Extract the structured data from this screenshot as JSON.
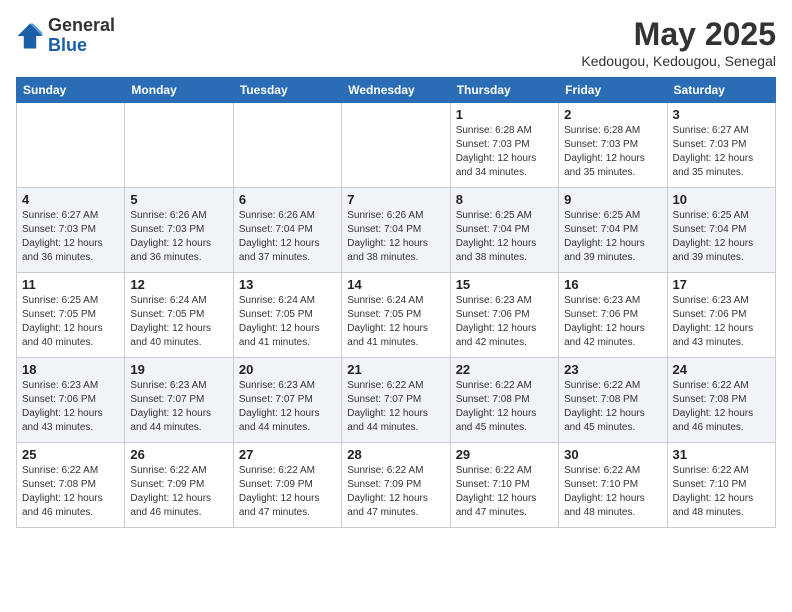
{
  "header": {
    "logo_line1": "General",
    "logo_line2": "Blue",
    "month": "May 2025",
    "location": "Kedougou, Kedougou, Senegal"
  },
  "weekdays": [
    "Sunday",
    "Monday",
    "Tuesday",
    "Wednesday",
    "Thursday",
    "Friday",
    "Saturday"
  ],
  "weeks": [
    [
      {
        "day": "",
        "info": ""
      },
      {
        "day": "",
        "info": ""
      },
      {
        "day": "",
        "info": ""
      },
      {
        "day": "",
        "info": ""
      },
      {
        "day": "1",
        "info": "Sunrise: 6:28 AM\nSunset: 7:03 PM\nDaylight: 12 hours and 34 minutes."
      },
      {
        "day": "2",
        "info": "Sunrise: 6:28 AM\nSunset: 7:03 PM\nDaylight: 12 hours and 35 minutes."
      },
      {
        "day": "3",
        "info": "Sunrise: 6:27 AM\nSunset: 7:03 PM\nDaylight: 12 hours and 35 minutes."
      }
    ],
    [
      {
        "day": "4",
        "info": "Sunrise: 6:27 AM\nSunset: 7:03 PM\nDaylight: 12 hours and 36 minutes."
      },
      {
        "day": "5",
        "info": "Sunrise: 6:26 AM\nSunset: 7:03 PM\nDaylight: 12 hours and 36 minutes."
      },
      {
        "day": "6",
        "info": "Sunrise: 6:26 AM\nSunset: 7:04 PM\nDaylight: 12 hours and 37 minutes."
      },
      {
        "day": "7",
        "info": "Sunrise: 6:26 AM\nSunset: 7:04 PM\nDaylight: 12 hours and 38 minutes."
      },
      {
        "day": "8",
        "info": "Sunrise: 6:25 AM\nSunset: 7:04 PM\nDaylight: 12 hours and 38 minutes."
      },
      {
        "day": "9",
        "info": "Sunrise: 6:25 AM\nSunset: 7:04 PM\nDaylight: 12 hours and 39 minutes."
      },
      {
        "day": "10",
        "info": "Sunrise: 6:25 AM\nSunset: 7:04 PM\nDaylight: 12 hours and 39 minutes."
      }
    ],
    [
      {
        "day": "11",
        "info": "Sunrise: 6:25 AM\nSunset: 7:05 PM\nDaylight: 12 hours and 40 minutes."
      },
      {
        "day": "12",
        "info": "Sunrise: 6:24 AM\nSunset: 7:05 PM\nDaylight: 12 hours and 40 minutes."
      },
      {
        "day": "13",
        "info": "Sunrise: 6:24 AM\nSunset: 7:05 PM\nDaylight: 12 hours and 41 minutes."
      },
      {
        "day": "14",
        "info": "Sunrise: 6:24 AM\nSunset: 7:05 PM\nDaylight: 12 hours and 41 minutes."
      },
      {
        "day": "15",
        "info": "Sunrise: 6:23 AM\nSunset: 7:06 PM\nDaylight: 12 hours and 42 minutes."
      },
      {
        "day": "16",
        "info": "Sunrise: 6:23 AM\nSunset: 7:06 PM\nDaylight: 12 hours and 42 minutes."
      },
      {
        "day": "17",
        "info": "Sunrise: 6:23 AM\nSunset: 7:06 PM\nDaylight: 12 hours and 43 minutes."
      }
    ],
    [
      {
        "day": "18",
        "info": "Sunrise: 6:23 AM\nSunset: 7:06 PM\nDaylight: 12 hours and 43 minutes."
      },
      {
        "day": "19",
        "info": "Sunrise: 6:23 AM\nSunset: 7:07 PM\nDaylight: 12 hours and 44 minutes."
      },
      {
        "day": "20",
        "info": "Sunrise: 6:23 AM\nSunset: 7:07 PM\nDaylight: 12 hours and 44 minutes."
      },
      {
        "day": "21",
        "info": "Sunrise: 6:22 AM\nSunset: 7:07 PM\nDaylight: 12 hours and 44 minutes."
      },
      {
        "day": "22",
        "info": "Sunrise: 6:22 AM\nSunset: 7:08 PM\nDaylight: 12 hours and 45 minutes."
      },
      {
        "day": "23",
        "info": "Sunrise: 6:22 AM\nSunset: 7:08 PM\nDaylight: 12 hours and 45 minutes."
      },
      {
        "day": "24",
        "info": "Sunrise: 6:22 AM\nSunset: 7:08 PM\nDaylight: 12 hours and 46 minutes."
      }
    ],
    [
      {
        "day": "25",
        "info": "Sunrise: 6:22 AM\nSunset: 7:08 PM\nDaylight: 12 hours and 46 minutes."
      },
      {
        "day": "26",
        "info": "Sunrise: 6:22 AM\nSunset: 7:09 PM\nDaylight: 12 hours and 46 minutes."
      },
      {
        "day": "27",
        "info": "Sunrise: 6:22 AM\nSunset: 7:09 PM\nDaylight: 12 hours and 47 minutes."
      },
      {
        "day": "28",
        "info": "Sunrise: 6:22 AM\nSunset: 7:09 PM\nDaylight: 12 hours and 47 minutes."
      },
      {
        "day": "29",
        "info": "Sunrise: 6:22 AM\nSunset: 7:10 PM\nDaylight: 12 hours and 47 minutes."
      },
      {
        "day": "30",
        "info": "Sunrise: 6:22 AM\nSunset: 7:10 PM\nDaylight: 12 hours and 48 minutes."
      },
      {
        "day": "31",
        "info": "Sunrise: 6:22 AM\nSunset: 7:10 PM\nDaylight: 12 hours and 48 minutes."
      }
    ]
  ]
}
